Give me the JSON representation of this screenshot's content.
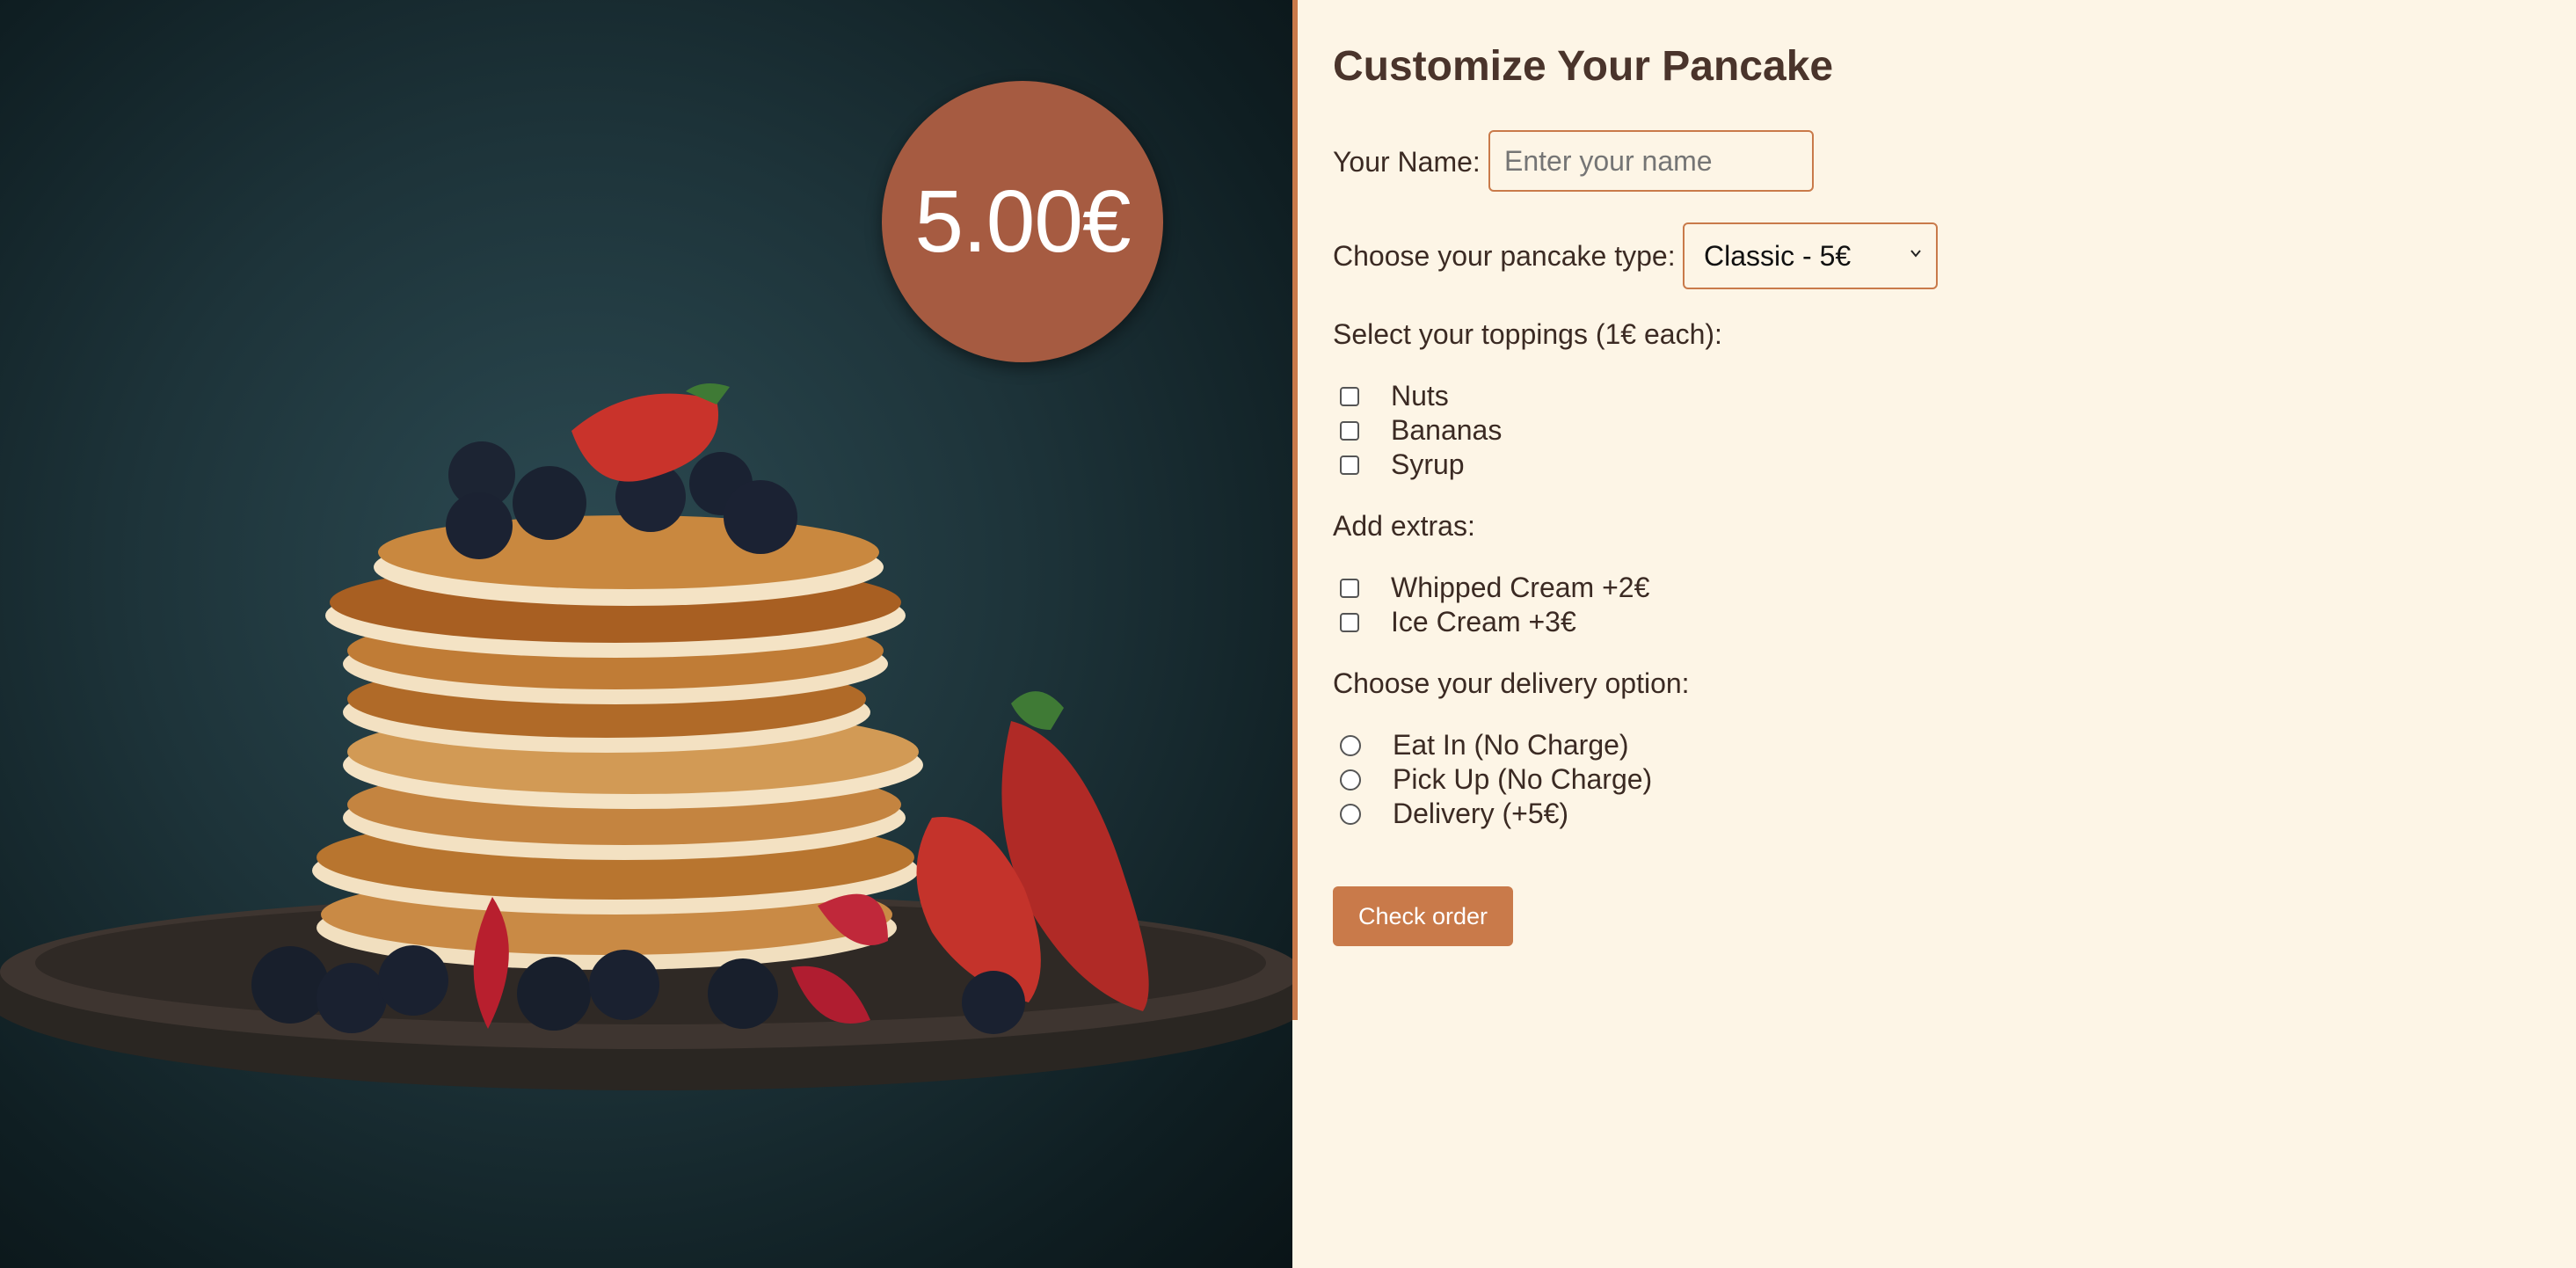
{
  "price_badge": {
    "value": "5.00€"
  },
  "form": {
    "title": "Customize Your Pancake",
    "name": {
      "label": "Your Name:",
      "placeholder": "Enter your name",
      "value": ""
    },
    "pancake_type": {
      "label": "Choose your pancake type:",
      "selected": "Classic - 5€"
    },
    "toppings": {
      "label": "Select your toppings (1€ each):",
      "options": [
        {
          "label": "Nuts",
          "checked": false
        },
        {
          "label": "Bananas",
          "checked": false
        },
        {
          "label": "Syrup",
          "checked": false
        }
      ]
    },
    "extras": {
      "label": "Add extras:",
      "options": [
        {
          "label": "Whipped Cream +2€",
          "checked": false
        },
        {
          "label": "Ice Cream +3€",
          "checked": false
        }
      ]
    },
    "delivery": {
      "label": "Choose your delivery option:",
      "options": [
        {
          "label": "Eat In (No Charge)",
          "selected": false
        },
        {
          "label": "Pick Up (No Charge)",
          "selected": false
        },
        {
          "label": "Delivery (+5€)",
          "selected": false
        }
      ]
    },
    "submit_label": "Check order"
  },
  "colors": {
    "accent": "#c97a4a",
    "badge": "#a65b41",
    "background": "#fdf5e6",
    "photo_background": "#1d3339"
  }
}
